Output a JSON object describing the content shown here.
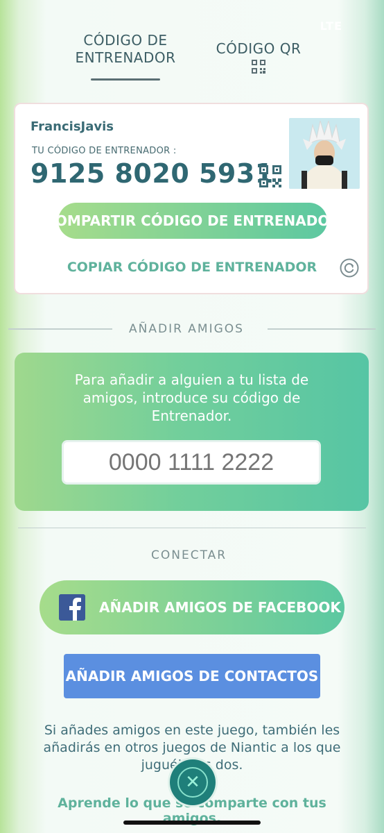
{
  "status_bar": {
    "network": "LTE"
  },
  "tabs": [
    {
      "label": "CÓDIGO DE ENTRENADOR",
      "active": true
    },
    {
      "label": "CÓDIGO QR",
      "active": false
    }
  ],
  "trainer": {
    "username": "FrancisJavis",
    "code_label": "TU CÓDIGO DE ENTRENADOR :",
    "code": "9125 8020 5931",
    "share_label": "COMPARTIR CÓDIGO DE ENTRENADOR",
    "copy_label": "COPIAR CÓDIGO DE ENTRENADOR"
  },
  "add_friends": {
    "section_title": "AÑADIR AMIGOS",
    "instructions": "Para añadir a alguien a tu lista de amigos, introduce su código de Entrenador.",
    "input_placeholder": "0000 1111 2222"
  },
  "connect": {
    "section_title": "CONECTAR",
    "facebook_label": "AÑADIR AMIGOS DE FACEBOOK",
    "contacts_label": "AÑADIR AMIGOS DE CONTACTOS",
    "info_text": "Si añades amigos en este juego, también les añadirás en otros juegos de Niantic a los que juguéis los dos.",
    "learn_more": "Aprende lo que se comparte con tus amigos."
  },
  "colors": {
    "accent_green": "#5cc8a1",
    "contacts_blue": "#5b8fe0",
    "facebook_blue": "#3b5998",
    "text_teal": "#2f6772"
  },
  "icons": [
    "qr-code-icon",
    "refresh-icon",
    "facebook-icon",
    "close-icon"
  ]
}
